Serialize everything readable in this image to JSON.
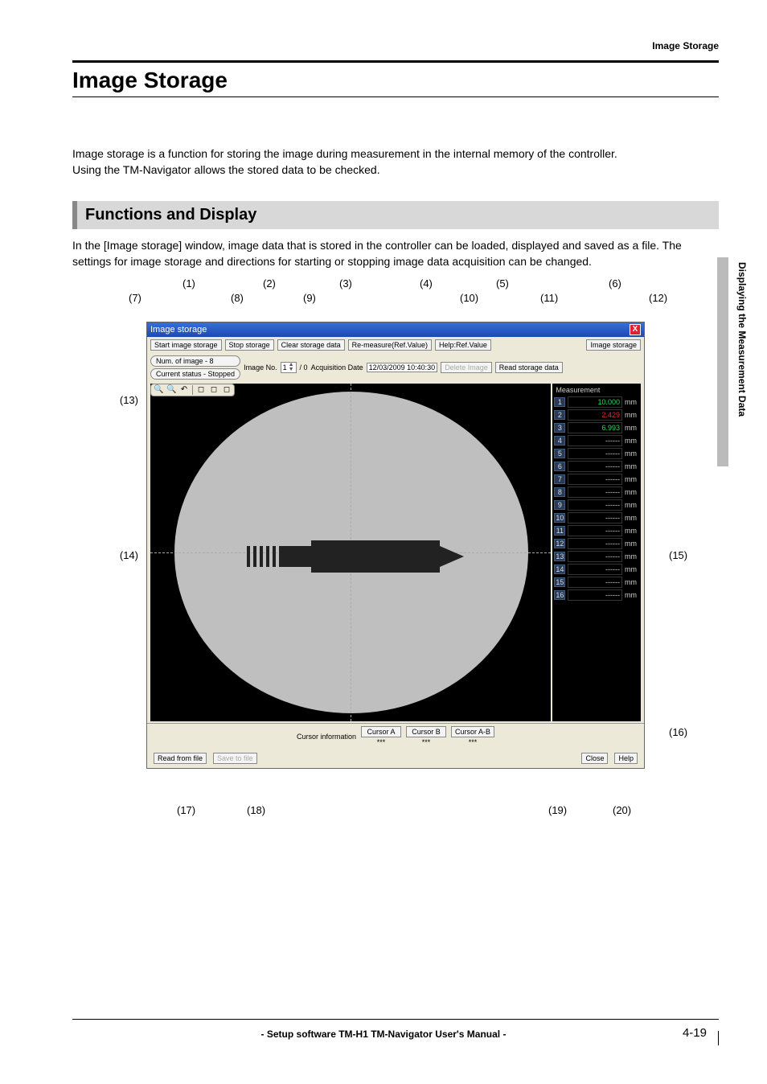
{
  "header_right": "Image Storage",
  "title": "Image Storage",
  "intro_line1": "Image storage is a function for storing the image during measurement in the internal memory of the controller.",
  "intro_line2": "Using the TM-Navigator allows the stored data to be checked.",
  "section_heading": "Functions and Display",
  "section_body": "In the [Image storage] window, image data that is stored in the controller can be loaded, displayed and saved as a file. The settings for image storage and directions for starting or stopping image data acquisition can be changed.",
  "side_label": "Displaying the Measurement Data",
  "callouts_top_row1": [
    "(1)",
    "(2)",
    "(3)",
    "(4)",
    "(5)",
    "(6)"
  ],
  "callouts_top_row2": [
    "(7)",
    "(8)",
    "(9)",
    "(10)",
    "(11)",
    "(12)"
  ],
  "callouts_left": {
    "c13": "(13)",
    "c14": "(14)"
  },
  "callouts_right": {
    "c15": "(15)",
    "c16": "(16)"
  },
  "callouts_bottom": {
    "c17": "(17)",
    "c18": "(18)",
    "c19": "(19)",
    "c20": "(20)"
  },
  "window": {
    "title": "Image storage",
    "close": "X",
    "buttons_row1": {
      "start": "Start image storage",
      "stop": "Stop storage",
      "clear": "Clear storage data",
      "remeasure": "Re-measure(Ref.Value)",
      "helpref": "Help:Ref.Value",
      "imgstore": "Image storage"
    },
    "row2": {
      "num_images": "Num. of image -   8",
      "current_status": "Current status -   Stopped",
      "image_no_label": "Image No.",
      "image_no_value": "1",
      "image_no_total": "/ 0",
      "acq_date_label": "Acquisition Date",
      "acq_date_value": "12/03/2009 10:40:30",
      "delete_image": "Delete Image",
      "read_storage": "Read storage data"
    },
    "toolbar_icons": [
      "zoom-in-icon",
      "zoom-out-icon",
      "undo-icon",
      "fit1-icon",
      "fit2-icon",
      "fit3-icon"
    ],
    "measurement": {
      "title": "Measurement",
      "rows": [
        {
          "idx": "1",
          "val": "10.000",
          "unit": "mm",
          "color": "#22dd55"
        },
        {
          "idx": "2",
          "val": "2.429",
          "unit": "mm",
          "color": "#ee2222"
        },
        {
          "idx": "3",
          "val": "6.993",
          "unit": "mm",
          "color": "#22dd55"
        },
        {
          "idx": "4",
          "val": "------",
          "unit": "mm",
          "color": "#cccccc"
        },
        {
          "idx": "5",
          "val": "------",
          "unit": "mm",
          "color": "#cccccc"
        },
        {
          "idx": "6",
          "val": "------",
          "unit": "mm",
          "color": "#cccccc"
        },
        {
          "idx": "7",
          "val": "------",
          "unit": "mm",
          "color": "#cccccc"
        },
        {
          "idx": "8",
          "val": "------",
          "unit": "mm",
          "color": "#cccccc"
        },
        {
          "idx": "9",
          "val": "------",
          "unit": "mm",
          "color": "#cccccc"
        },
        {
          "idx": "10",
          "val": "------",
          "unit": "mm",
          "color": "#cccccc"
        },
        {
          "idx": "11",
          "val": "------",
          "unit": "mm",
          "color": "#cccccc"
        },
        {
          "idx": "12",
          "val": "------",
          "unit": "mm",
          "color": "#cccccc"
        },
        {
          "idx": "13",
          "val": "------",
          "unit": "mm",
          "color": "#cccccc"
        },
        {
          "idx": "14",
          "val": "------",
          "unit": "mm",
          "color": "#cccccc"
        },
        {
          "idx": "15",
          "val": "------",
          "unit": "mm",
          "color": "#cccccc"
        },
        {
          "idx": "16",
          "val": "------",
          "unit": "mm",
          "color": "#cccccc"
        }
      ]
    },
    "cursorbar": {
      "label": "Cursor information",
      "a": "Cursor A",
      "a_val": "***",
      "b": "Cursor B",
      "b_val": "***",
      "ab": "Cursor A-B",
      "ab_val": "***"
    },
    "bottom": {
      "read": "Read from file",
      "save": "Save to file",
      "close": "Close",
      "help": "Help"
    }
  },
  "footer_manual": "- Setup software TM-H1 TM-Navigator User's Manual -",
  "page_number": "4-19"
}
